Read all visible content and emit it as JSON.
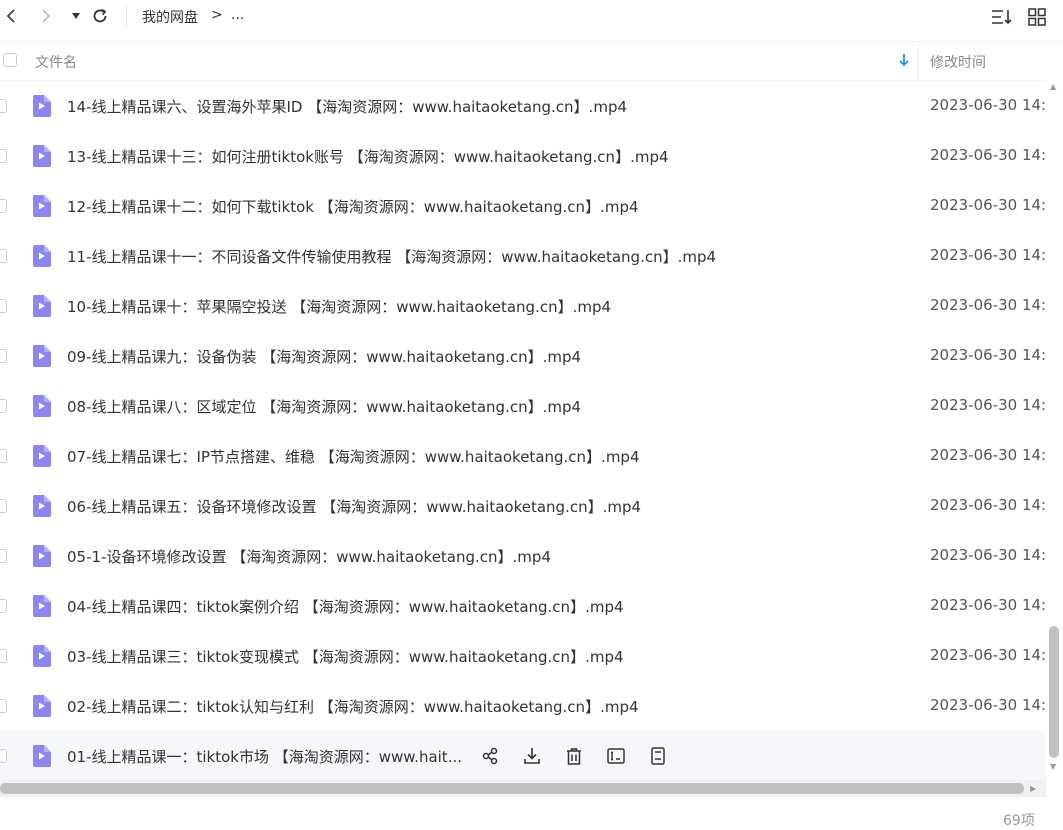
{
  "toolbar": {
    "breadcrumb_root": "我的网盘",
    "breadcrumb_sep": ">",
    "breadcrumb_more": "..."
  },
  "table": {
    "columns": {
      "name": "文件名",
      "modified": "修改时间"
    },
    "rows": [
      {
        "name": "14-线上精品课六、设置海外苹果ID 【海淘资源网：www.haitaoketang.cn】.mp4",
        "time": "2023-06-30 14:"
      },
      {
        "name": "13-线上精品课十三：如何注册tiktok账号 【海淘资源网：www.haitaoketang.cn】.mp4",
        "time": "2023-06-30 14:"
      },
      {
        "name": "12-线上精品课十二：如何下载tiktok 【海淘资源网：www.haitaoketang.cn】.mp4",
        "time": "2023-06-30 14:"
      },
      {
        "name": "11-线上精品课十一：不同设备文件传输使用教程 【海淘资源网：www.haitaoketang.cn】.mp4",
        "time": "2023-06-30 14:"
      },
      {
        "name": "10-线上精品课十：苹果隔空投送 【海淘资源网：www.haitaoketang.cn】.mp4",
        "time": "2023-06-30 14:"
      },
      {
        "name": "09-线上精品课九：设备伪装 【海淘资源网：www.haitaoketang.cn】.mp4",
        "time": "2023-06-30 14:"
      },
      {
        "name": "08-线上精品课八：区域定位 【海淘资源网：www.haitaoketang.cn】.mp4",
        "time": "2023-06-30 14:"
      },
      {
        "name": "07-线上精品课七：IP节点搭建、维稳 【海淘资源网：www.haitaoketang.cn】.mp4",
        "time": "2023-06-30 14:"
      },
      {
        "name": "06-线上精品课五：设备环境修改设置 【海淘资源网：www.haitaoketang.cn】.mp4",
        "time": "2023-06-30 14:"
      },
      {
        "name": "05-1-设备环境修改设置 【海淘资源网：www.haitaoketang.cn】.mp4",
        "time": "2023-06-30 14:"
      },
      {
        "name": "04-线上精品课四：tiktok案例介绍 【海淘资源网：www.haitaoketang.cn】.mp4",
        "time": "2023-06-30 14:"
      },
      {
        "name": "03-线上精品课三：tiktok变现模式 【海淘资源网：www.haitaoketang.cn】.mp4",
        "time": "2023-06-30 14:"
      },
      {
        "name": "02-线上精品课二：tiktok认知与红利 【海淘资源网：www.haitaoketang.cn】.mp4",
        "time": "2023-06-30 14:"
      },
      {
        "name": "01-线上精品课一：tiktok市场 【海淘资源网：www.hait...",
        "time": ""
      }
    ]
  },
  "footer": {
    "count": "69项"
  },
  "colors": {
    "accent": "#1e90ff",
    "file_icon": "#8b86f0",
    "hover_row": "#f5f7fb"
  }
}
